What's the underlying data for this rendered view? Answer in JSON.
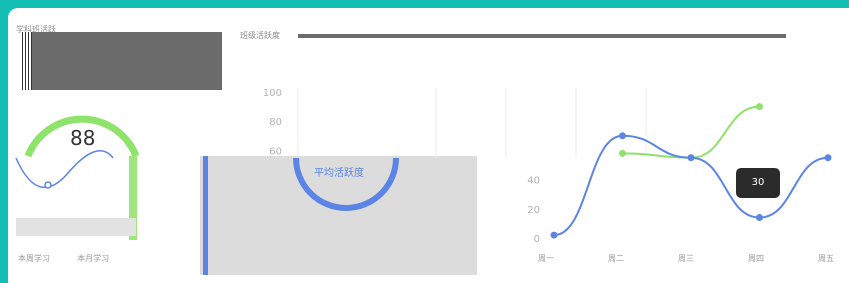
{
  "panel_left": {
    "title": "学科班活跃",
    "gauge_value": "88",
    "tabs": [
      "本周学习",
      "本月学习"
    ]
  },
  "panel_top": {
    "title": "班级活跃度"
  },
  "panel_center": {
    "donut_label": "平均活跃度"
  },
  "colors": {
    "accent_blue": "#5b84e6",
    "accent_green": "#8fe36a",
    "background_teal": "#13bfb4"
  },
  "chart_data": [
    {
      "type": "line",
      "yticks": [
        "100",
        "80",
        "60",
        "40",
        "20",
        "0"
      ],
      "categories": [
        "周一",
        "周二",
        "周三",
        "周四",
        "周五"
      ],
      "series": [
        {
          "color": "#8fe36a",
          "values": [
            null,
            58,
            55,
            90,
            null
          ]
        },
        {
          "color": "#5b84e6",
          "values": [
            2,
            70,
            55,
            14,
            55
          ]
        }
      ],
      "tooltip": {
        "value": "30"
      },
      "ylim": [
        0,
        100
      ]
    }
  ]
}
